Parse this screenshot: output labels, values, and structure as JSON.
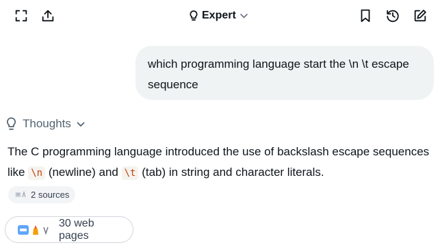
{
  "header": {
    "model_label": "Expert",
    "icons": {
      "expand": "expand-icon",
      "share": "share-icon",
      "model": "lightbulb-icon",
      "dropdown": "chevron-down-icon",
      "bookmark": "bookmark-icon",
      "history": "history-icon",
      "new_chat": "edit-icon"
    }
  },
  "user_message": {
    "text": "which programming language start the \\n \\t escape sequence"
  },
  "thoughts": {
    "label": "Thoughts"
  },
  "answer": {
    "part1": "The C programming language introduced the use of backslash escape sequences like ",
    "code1": "\\n",
    "part2": " (newline) and ",
    "code2": "\\t",
    "part3": " (tab) in string and character literals."
  },
  "sources": {
    "label": "2 sources"
  },
  "web_pages": {
    "label": "30 web pages"
  },
  "colors": {
    "bubble_bg": "#eff3f4",
    "muted_text": "#536471",
    "code_text": "#c2410c",
    "code_bg": "#f6f3ef"
  }
}
